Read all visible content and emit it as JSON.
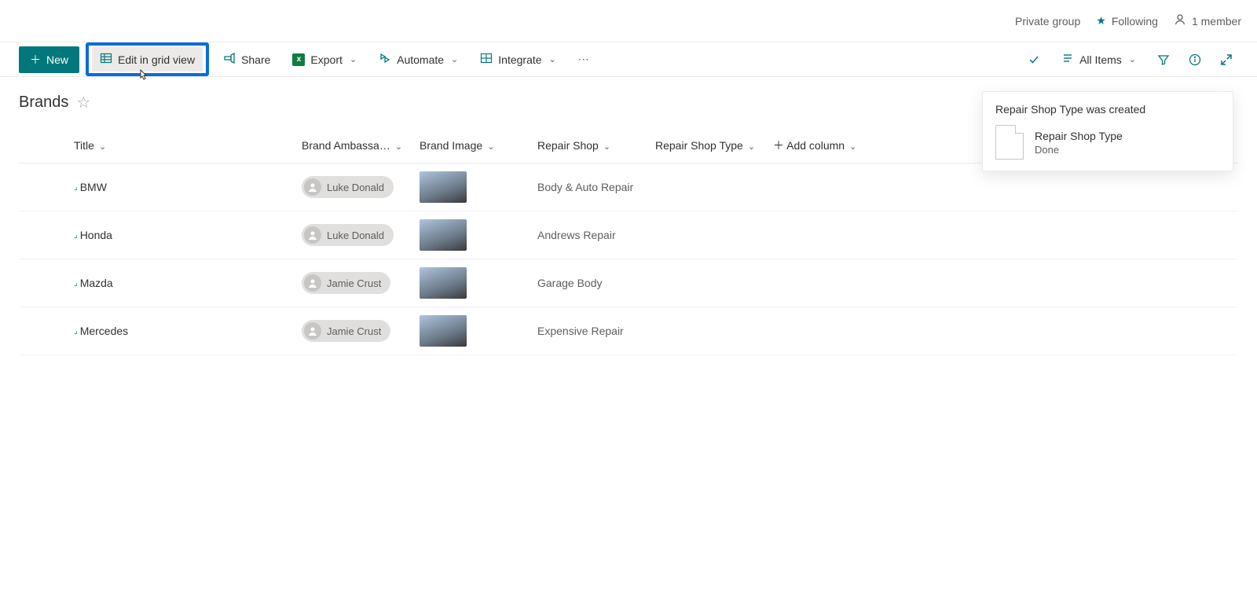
{
  "topbar": {
    "private_group": "Private group",
    "following": "Following",
    "members": "1 member"
  },
  "commands": {
    "new": "New",
    "edit_grid": "Edit in grid view",
    "share": "Share",
    "export": "Export",
    "automate": "Automate",
    "integrate": "Integrate",
    "all_items": "All Items"
  },
  "page": {
    "title": "Brands"
  },
  "columns": {
    "title": "Title",
    "ambassador": "Brand Ambassa…",
    "brand_image": "Brand Image",
    "repair_shop": "Repair Shop",
    "repair_shop_type": "Repair Shop Type",
    "add_column": "Add column"
  },
  "rows": [
    {
      "title": "BMW",
      "ambassador": "Luke Donald",
      "repair_shop": "Body & Auto Repair"
    },
    {
      "title": "Honda",
      "ambassador": "Luke Donald",
      "repair_shop": "Andrews Repair"
    },
    {
      "title": "Mazda",
      "ambassador": "Jamie Crust",
      "repair_shop": "Garage Body"
    },
    {
      "title": "Mercedes",
      "ambassador": "Jamie Crust",
      "repair_shop": "Expensive Repair"
    }
  ],
  "toast": {
    "heading": "Repair Shop Type was created",
    "name": "Repair Shop Type",
    "status": "Done"
  }
}
